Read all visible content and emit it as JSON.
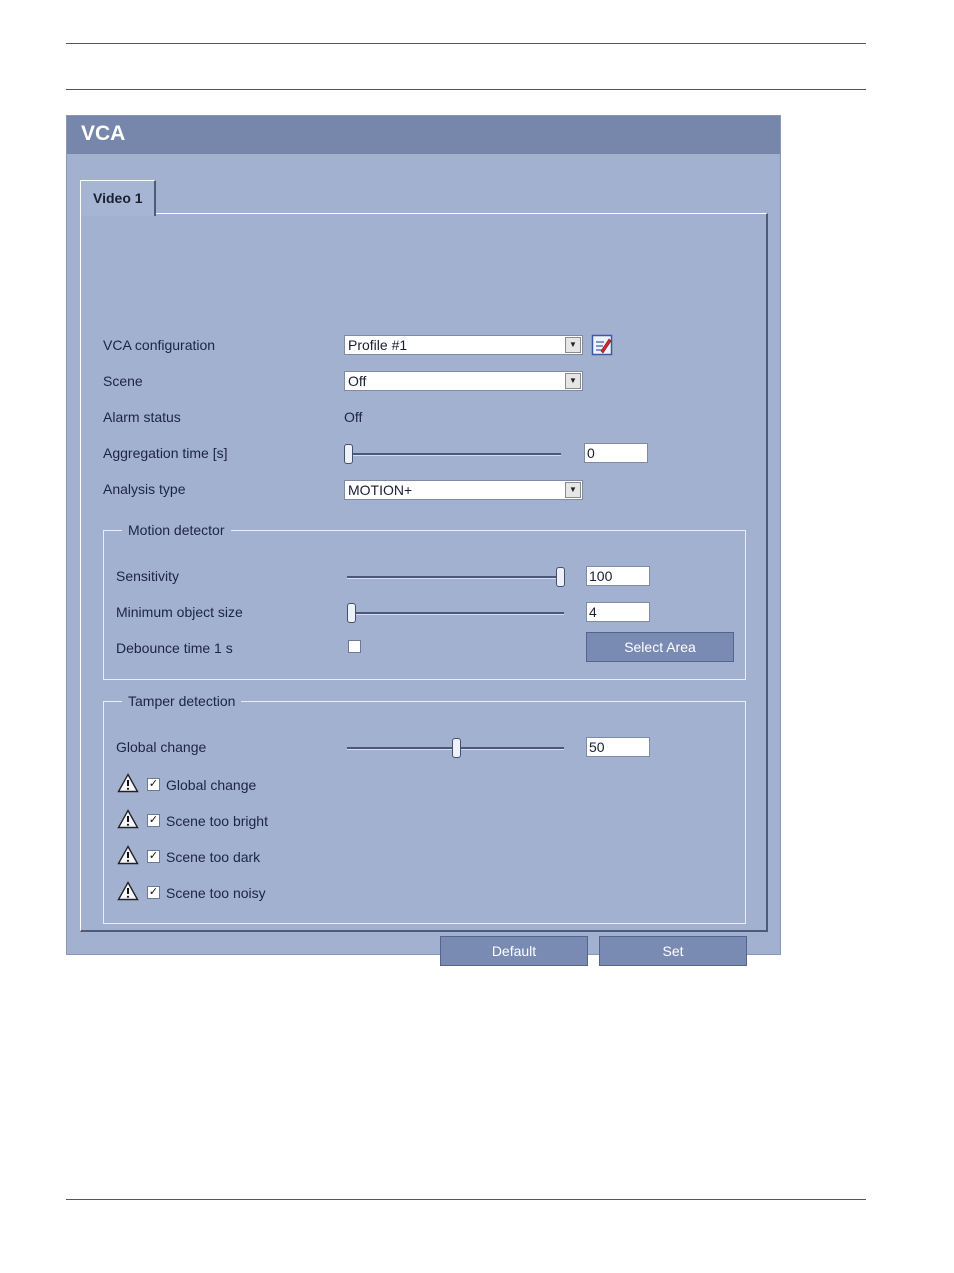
{
  "window": {
    "title": "VCA"
  },
  "tabs": [
    {
      "label": "Video 1",
      "active": true
    }
  ],
  "form": {
    "vca_configuration": {
      "label": "VCA configuration",
      "value": "Profile #1"
    },
    "scene": {
      "label": "Scene",
      "value": "Off"
    },
    "alarm_status": {
      "label": "Alarm status",
      "value": "Off"
    },
    "aggregation_time": {
      "label": "Aggregation time [s]",
      "value": "0",
      "level": 0
    },
    "analysis_type": {
      "label": "Analysis type",
      "value": "MOTION+"
    }
  },
  "motion_detector": {
    "legend": "Motion detector",
    "sensitivity": {
      "label": "Sensitivity",
      "value": "100",
      "level": 1.0
    },
    "minimum_object_size": {
      "label": "Minimum object size",
      "value": "4",
      "level": 0
    },
    "debounce": {
      "label": "Debounce time 1 s",
      "checked": false
    },
    "select_area_label": "Select Area"
  },
  "tamper_detection": {
    "legend": "Tamper detection",
    "global_change": {
      "label": "Global change",
      "value": "50",
      "level": 0.5
    },
    "checks": [
      {
        "label": "Global change",
        "checked": true
      },
      {
        "label": "Scene too bright",
        "checked": true
      },
      {
        "label": "Scene too dark",
        "checked": true
      },
      {
        "label": "Scene too noisy",
        "checked": true
      }
    ]
  },
  "buttons": {
    "default_label": "Default",
    "set_label": "Set"
  },
  "colors": {
    "panel": "#a2b1d0",
    "titlebar": "#7787ab",
    "button": "#7a8bb3"
  },
  "icons": {
    "edit": "edit-profile-icon",
    "warning": "warning-icon",
    "dropdown": "chevron-down-icon"
  }
}
